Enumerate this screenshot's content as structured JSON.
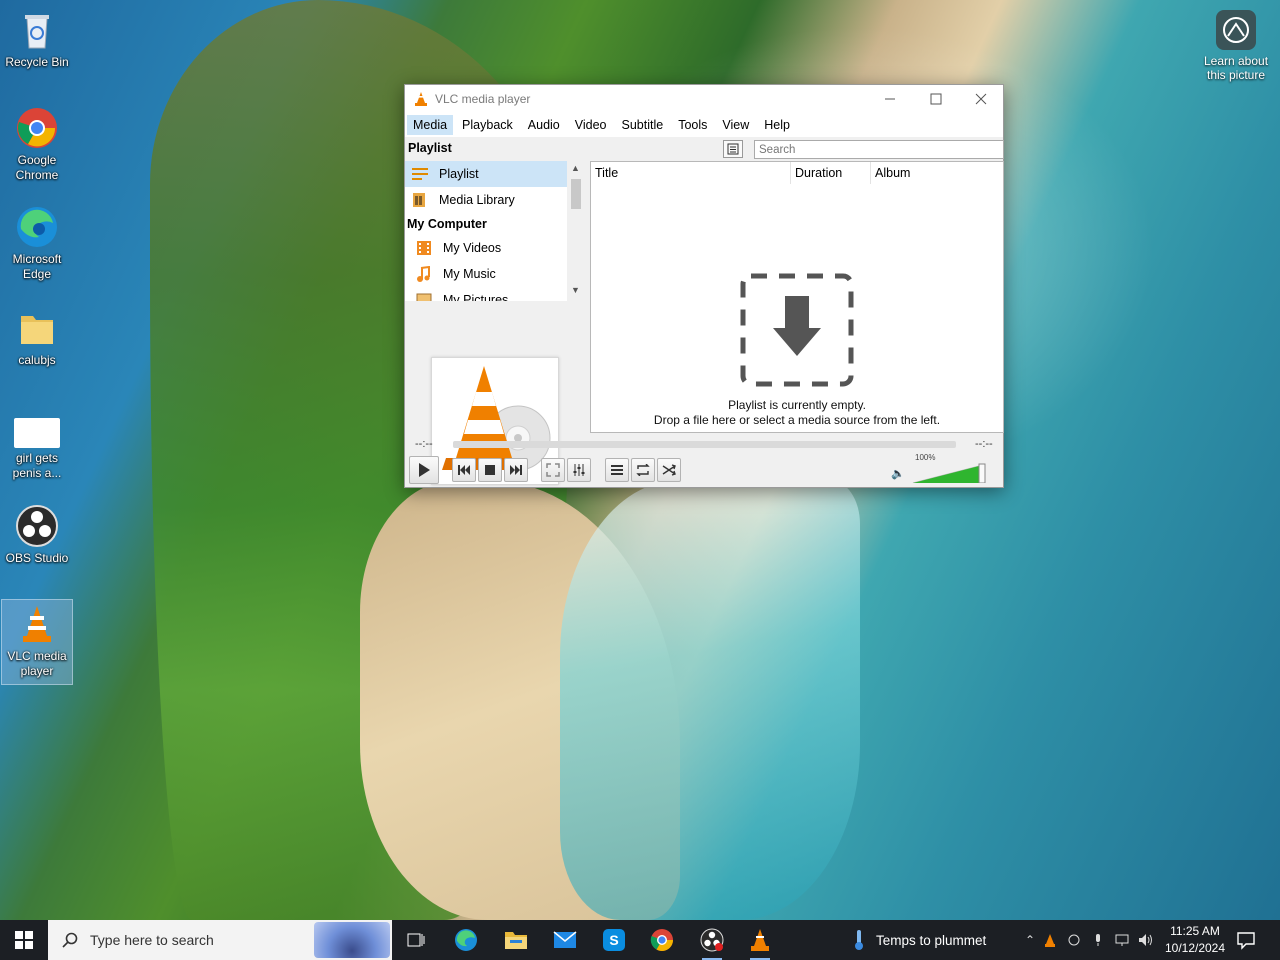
{
  "desktop": {
    "icons": [
      {
        "label": "Recycle Bin"
      },
      {
        "label": "Google Chrome"
      },
      {
        "label": "Microsoft Edge"
      },
      {
        "label": "calubjs"
      },
      {
        "label": "girl gets penis a..."
      },
      {
        "label": "OBS Studio"
      },
      {
        "label": "VLC media player"
      }
    ],
    "learn_label": "Learn about this picture"
  },
  "vlc": {
    "title": "VLC media player",
    "menu": [
      "Media",
      "Playback",
      "Audio",
      "Video",
      "Subtitle",
      "Tools",
      "View",
      "Help"
    ],
    "active_menu": "Media",
    "playlist_header": "Playlist",
    "sidebar": {
      "items": [
        {
          "label": "Playlist",
          "icon": "playlist-icon",
          "selected": true
        },
        {
          "label": "Media Library",
          "icon": "media-library-icon"
        }
      ],
      "category": "My Computer",
      "computer_items": [
        {
          "label": "My Videos",
          "icon": "film-icon"
        },
        {
          "label": "My Music",
          "icon": "music-note-icon"
        },
        {
          "label": "My Pictures",
          "icon": "picture-icon"
        }
      ]
    },
    "search_placeholder": "Search",
    "columns": [
      "Title",
      "Duration",
      "Album"
    ],
    "empty_line1": "Playlist is currently empty.",
    "empty_line2": "Drop a file here or select a media source from the left.",
    "time_elapsed": "--:--",
    "time_total": "--:--",
    "volume_label": "100%",
    "volume_level": 1.0,
    "colors": {
      "accent": "#cce4f7",
      "volume": "#2fb52f",
      "cone": "#f08000"
    }
  },
  "taskbar": {
    "search_placeholder": "Type here to search",
    "weather": "Temps to plummet",
    "time": "11:25 AM",
    "date": "10/12/2024",
    "pinned": [
      "task-view-icon",
      "edge-icon",
      "file-explorer-icon",
      "mail-icon",
      "skype-icon",
      "chrome-icon",
      "obs-icon",
      "vlc-icon"
    ]
  }
}
